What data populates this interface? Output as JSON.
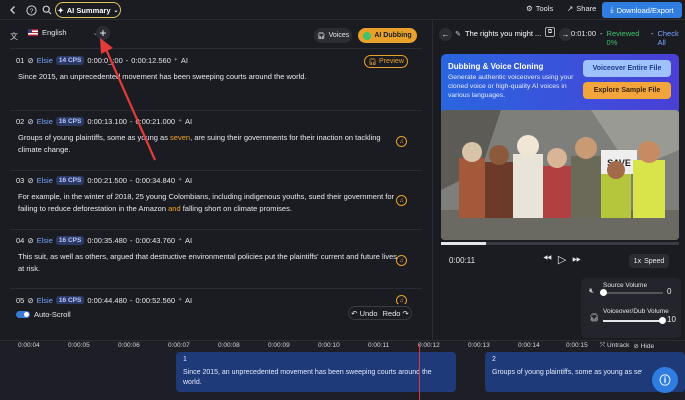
{
  "topbar": {
    "summary_label": "AI Summary",
    "tools_label": "Tools",
    "share_label": "Share",
    "download_label": "Download/Export"
  },
  "editor": {
    "language": "English",
    "voices_label": "Voices",
    "dubbing_label": "AI Dubbing",
    "preview_label": "Preview",
    "autoscroll_label": "Auto-Scroll",
    "undo_label": "Undo",
    "redo_label": "Redo"
  },
  "segments": [
    {
      "num": "01",
      "speaker": "Elsie",
      "cps": "14 CPS",
      "start": "0:00:0_:00",
      "end": "0:00:12.560",
      "ai": "AI",
      "text_a": "Since 2015, an unprecedented movement has been sweeping courts around the world.",
      "hl": "",
      "text_b": ""
    },
    {
      "num": "02",
      "speaker": "Elsie",
      "cps": "16 CPS",
      "start": "0:00:13.100",
      "end": "0:00:21.000",
      "ai": "AI",
      "text_a": "Groups of young plaintiffs, some as young as ",
      "hl": "seven",
      "text_b": ", are suing their governments for their inaction on tackling climate change."
    },
    {
      "num": "03",
      "speaker": "Elsie",
      "cps": "16 CPS",
      "start": "0:00:21.500",
      "end": "0:00:34.840",
      "ai": "AI",
      "text_a": "For example, in the winter of 2018, 25 young Colombians, including indigenous youths, sued their government for failing to reduce deforestation in the Amazon ",
      "hl": "and",
      "text_b": " falling short on climate promises."
    },
    {
      "num": "04",
      "speaker": "Elsie",
      "cps": "16 CPS",
      "start": "0:00:35.480",
      "end": "0:00:43.760",
      "ai": "AI",
      "text_a": "This suit, as well as others, argued that destructive environmental policies put the plaintiffs' current and future lives at risk.",
      "hl": "",
      "text_b": ""
    },
    {
      "num": "05",
      "speaker": "Elsie",
      "cps": "16 CPS",
      "start": "0:00:44.480",
      "end": "0:00:52.560",
      "ai": "AI",
      "text_a": "",
      "hl": "",
      "text_b": ""
    }
  ],
  "right": {
    "video_title": "The rights you might ...",
    "time_range": "0:01:00",
    "reviewed": "Reviewed 0%",
    "check_all": "Check All",
    "promo_title": "Dubbing & Voice Cloning",
    "promo_text": "Generate authentic voiceovers using your cloned voice or high-quality AI voices in various languages.",
    "voiceover_btn": "Voiceover Entire File",
    "sample_btn": "Explore Sample File",
    "current_time": "0:00:11",
    "speed_label": "Speed",
    "speed_value": "1x",
    "source_volume_label": "Source Volume",
    "source_volume": "0",
    "dub_volume_label": "Voiceover/Dub Volume",
    "dub_volume": "10",
    "video_sign": "SAVE"
  },
  "timeline": {
    "ticks": [
      "0:00:04",
      "0:00:05",
      "0:00:06",
      "0:00:07",
      "0:00:08",
      "0:00:09",
      "0:00:10",
      "0:00:11",
      "0:00:12",
      "0:00:13",
      "0:00:14",
      "0:00:15"
    ],
    "untrack_label": "Untrack",
    "hide_label": "Hide",
    "seg1_num": "1",
    "seg1_text": "Since 2015, an unprecedented movement has been sweeping courts around the world.",
    "seg2_num": "2",
    "seg2_text": "Groups of young plaintiffs, some as young as seven, are suing their governments for their inaction on tackling climate change."
  },
  "colors": {
    "accent_blue": "#2f7de1",
    "accent_orange": "#e8a12b",
    "highlight_yellow": "#e2c25a",
    "panel_bg": "#1b1c22",
    "segment_blue": "#1e3a78"
  }
}
